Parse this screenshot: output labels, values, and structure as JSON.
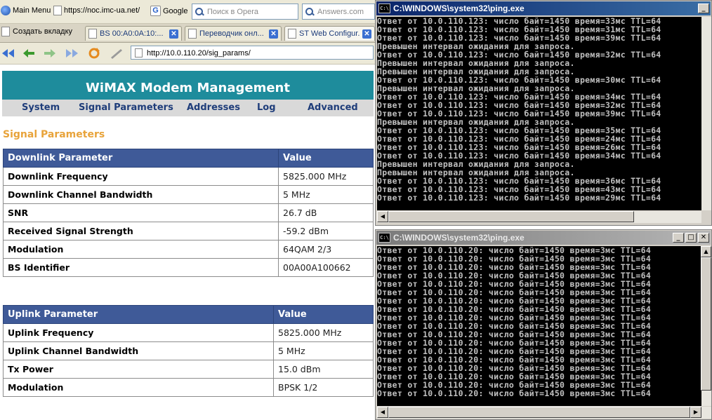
{
  "browser": {
    "bookmarks": {
      "main_menu": "Main Menu",
      "noc_link": "https://noc.imc-ua.net/",
      "google": "Google",
      "opera_search_placeholder": "Поиск в Opera",
      "answers_placeholder": "Answers.com"
    },
    "tabs": {
      "new_tab": "Создать вкладку",
      "items": [
        {
          "label": "BS 00:A0:0A:10:..."
        },
        {
          "label": "Переводчик онл..."
        },
        {
          "label": "ST Web Configur..."
        }
      ]
    },
    "address": "http://10.0.110.20/sig_params/"
  },
  "page": {
    "banner": "WiMAX Modem Management",
    "menu": [
      "System",
      "Signal Parameters",
      "Addresses",
      "Log",
      "Advanced"
    ],
    "title": "Signal Parameters",
    "downlink": {
      "header_param": "Downlink Parameter",
      "header_value": "Value",
      "rows": [
        {
          "name": "Downlink Frequency",
          "value": "5825.000 MHz"
        },
        {
          "name": "Downlink Channel Bandwidth",
          "value": "5 MHz"
        },
        {
          "name": "SNR",
          "value": "26.7 dB"
        },
        {
          "name": "Received Signal Strength",
          "value": "-59.2 dBm"
        },
        {
          "name": "Modulation",
          "value": "64QAM 2/3"
        },
        {
          "name": "BS Identifier",
          "value": "00A00A100662"
        }
      ]
    },
    "uplink": {
      "header_param": "Uplink Parameter",
      "header_value": "Value",
      "rows": [
        {
          "name": "Uplink Frequency",
          "value": "5825.000 MHz"
        },
        {
          "name": "Uplink Channel Bandwidth",
          "value": "5 MHz"
        },
        {
          "name": "Tx Power",
          "value": "15.0 dBm"
        },
        {
          "name": "Modulation",
          "value": "BPSK 1/2"
        }
      ]
    }
  },
  "console1": {
    "title": "C:\\WINDOWS\\system32\\ping.exe",
    "icon": "C:\\",
    "lines": [
      "Ответ от 10.0.110.123: число байт=1450 время=33мс TTL=64",
      "Ответ от 10.0.110.123: число байт=1450 время=31мс TTL=64",
      "Ответ от 10.0.110.123: число байт=1450 время=39мс TTL=64",
      "Превышен интервал ожидания для запроса.",
      "Ответ от 10.0.110.123: число байт=1450 время=32мс TTL=64",
      "Превышен интервал ожидания для запроса.",
      "Превышен интервал ожидания для запроса.",
      "Ответ от 10.0.110.123: число байт=1450 время=30мс TTL=64",
      "Превышен интервал ожидания для запроса.",
      "Ответ от 10.0.110.123: число байт=1450 время=34мс TTL=64",
      "Ответ от 10.0.110.123: число байт=1450 время=32мс TTL=64",
      "Ответ от 10.0.110.123: число байт=1450 время=39мс TTL=64",
      "Превышен интервал ожидания для запроса.",
      "Ответ от 10.0.110.123: число байт=1450 время=35мс TTL=64",
      "Ответ от 10.0.110.123: число байт=1450 время=24мс TTL=64",
      "Ответ от 10.0.110.123: число байт=1450 время=26мс TTL=64",
      "Ответ от 10.0.110.123: число байт=1450 время=34мс TTL=64",
      "Превышен интервал ожидания для запроса.",
      "Превышен интервал ожидания для запроса.",
      "Ответ от 10.0.110.123: число байт=1450 время=36мс TTL=64",
      "Ответ от 10.0.110.123: число байт=1450 время=43мс TTL=64",
      "Ответ от 10.0.110.123: число байт=1450 время=29мс TTL=64"
    ]
  },
  "console2": {
    "title": "C:\\WINDOWS\\system32\\ping.exe",
    "icon": "C:\\",
    "lines": [
      "Ответ от 10.0.110.20: число байт=1450 время=3мс TTL=64",
      "Ответ от 10.0.110.20: число байт=1450 время=3мс TTL=64",
      "Ответ от 10.0.110.20: число байт=1450 время=3мс TTL=64",
      "Ответ от 10.0.110.20: число байт=1450 время=3мс TTL=64",
      "Ответ от 10.0.110.20: число байт=1450 время=3мс TTL=64",
      "Ответ от 10.0.110.20: число байт=1450 время=3мс TTL=64",
      "Ответ от 10.0.110.20: число байт=1450 время=3мс TTL=64",
      "Ответ от 10.0.110.20: число байт=1450 время=3мс TTL=64",
      "Ответ от 10.0.110.20: число байт=1450 время=3мс TTL=64",
      "Ответ от 10.0.110.20: число байт=1450 время=3мс TTL=64",
      "Ответ от 10.0.110.20: число байт=1450 время=3мс TTL=64",
      "Ответ от 10.0.110.20: число байт=1450 время=3мс TTL=64",
      "Ответ от 10.0.110.20: число байт=1450 время=3мс TTL=64",
      "Ответ от 10.0.110.20: число байт=1450 время=3мс TTL=64",
      "Ответ от 10.0.110.20: число байт=1450 время=3мс TTL=64",
      "Ответ от 10.0.110.20: число байт=1450 время=3мс TTL=64",
      "Ответ от 10.0.110.20: число байт=1450 время=3мс TTL=64",
      "Ответ от 10.0.110.20: число байт=1450 время=3мс TTL=64"
    ]
  },
  "colors": {
    "banner": "#1e8c9c",
    "table_header": "#3f5a98",
    "page_title": "#e8a33a",
    "menu_text": "#1f3d7a",
    "console_bg": "#000000",
    "console_text": "#c0c0c0"
  }
}
